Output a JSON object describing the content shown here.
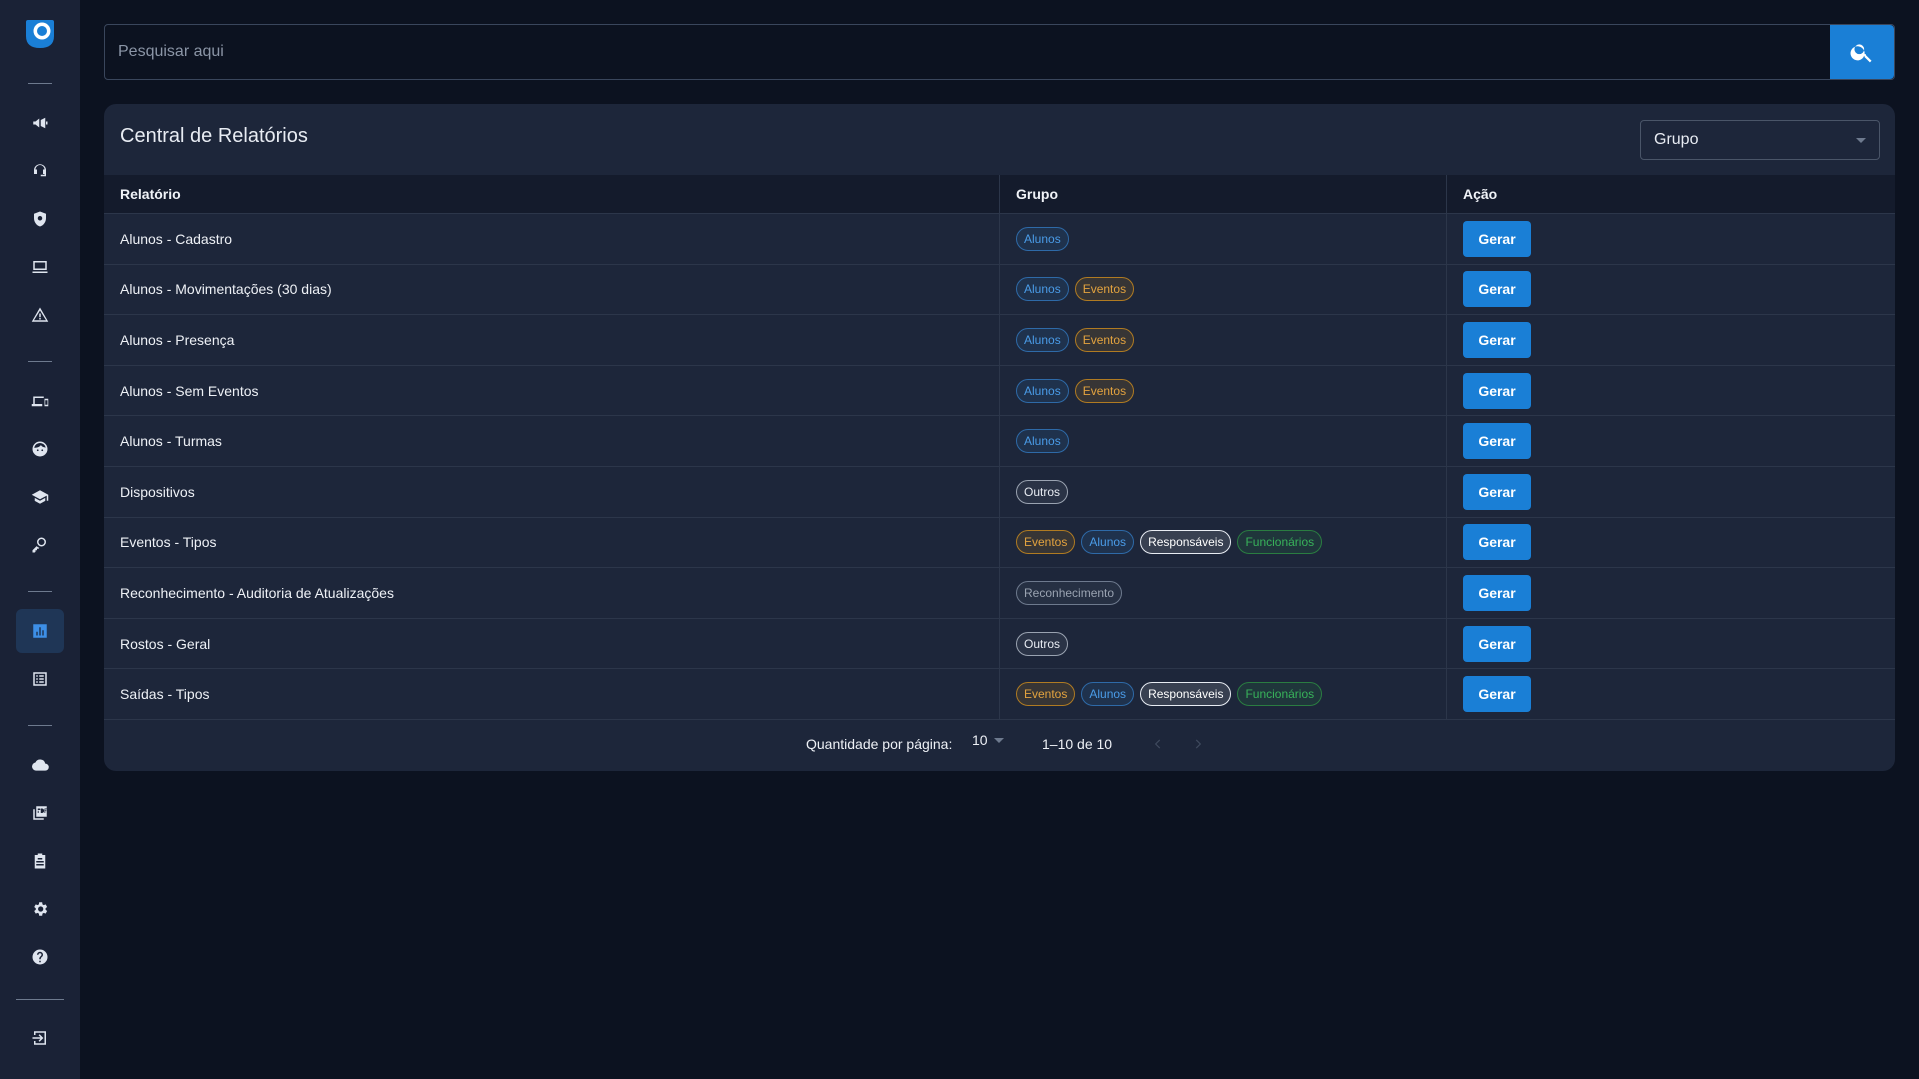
{
  "search": {
    "placeholder": "Pesquisar aqui"
  },
  "icons": {
    "logo": "app-logo",
    "search": "search-icon",
    "sidebar": [
      "megaphone-icon",
      "support-agent-icon",
      "shield-icon",
      "monitor-icon",
      "warning-icon",
      "devices-icon",
      "face-icon",
      "graduation-cap-icon",
      "person-key-icon",
      "bar-chart-icon",
      "list-icon",
      "cloud-icon",
      "pdf-icon",
      "clipboard-icon",
      "gear-icon",
      "help-icon",
      "logout-icon"
    ]
  },
  "colors": {
    "accent": "#1a7fd6",
    "background": "#0c1220",
    "sidebar": "#1a2236",
    "card": "#1d263a"
  },
  "card": {
    "title": "Central de Relatórios",
    "group_select": "Grupo"
  },
  "table": {
    "headers": {
      "report": "Relatório",
      "group": "Grupo",
      "action": "Ação"
    },
    "rows": [
      {
        "name": "Alunos - Cadastro",
        "action": "Gerar"
      },
      {
        "name": "Alunos - Movimentações (30 dias)",
        "action": "Gerar"
      },
      {
        "name": "Alunos - Presença",
        "action": "Gerar"
      },
      {
        "name": "Alunos - Sem Eventos",
        "action": "Gerar"
      },
      {
        "name": "Alunos - Turmas",
        "action": "Gerar"
      },
      {
        "name": "Dispositivos",
        "action": "Gerar"
      },
      {
        "name": "Eventos - Tipos",
        "action": "Gerar"
      },
      {
        "name": "Reconhecimento - Auditoria de Atualizações",
        "action": "Gerar"
      },
      {
        "name": "Rostos - Geral",
        "action": "Gerar"
      },
      {
        "name": "Saídas - Tipos",
        "action": "Gerar"
      }
    ],
    "chips": {
      "alunos": "Alunos",
      "eventos": "Eventos",
      "outros": "Outros",
      "responsaveis": "Responsáveis",
      "funcionarios": "Funcionários",
      "reconhecimento": "Reconhecimento"
    }
  },
  "pagination": {
    "per_page_label": "Quantidade por página:",
    "per_page_value": "10",
    "range": "1–10 de 10"
  }
}
